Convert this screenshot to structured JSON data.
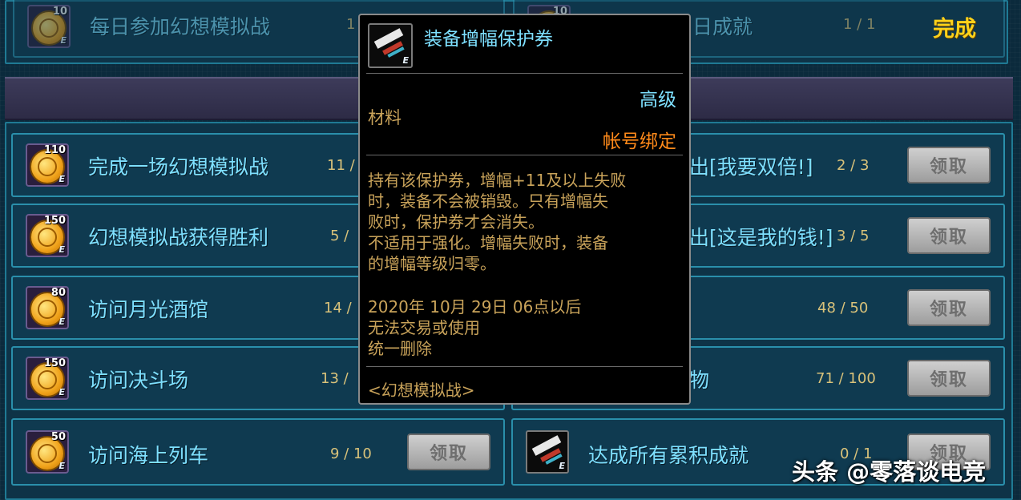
{
  "top_row": {
    "left": {
      "reward": "10",
      "task": "每日参加幻想模拟战",
      "progress": "1"
    },
    "right": {
      "reward": "10",
      "task": "日成就",
      "progress": "1 / 1",
      "status": "完成"
    }
  },
  "rows": [
    {
      "left": {
        "reward": "110",
        "task": "完成一场幻想模拟战",
        "progress": "11 /"
      },
      "right": {
        "task": "出[我要双倍!]",
        "progress": "2 / 3",
        "button": "领取"
      }
    },
    {
      "left": {
        "reward": "150",
        "task": "幻想模拟战获得胜利",
        "progress": "5 /"
      },
      "right": {
        "task": "出[这是我的钱!]",
        "progress": "3 / 5",
        "button": "领取"
      }
    },
    {
      "left": {
        "reward": "80",
        "task": "访问月光酒馆",
        "progress": "14 /"
      },
      "right": {
        "task": "",
        "progress": "48 / 50",
        "button": "领取"
      }
    },
    {
      "left": {
        "reward": "150",
        "task": "访问决斗场",
        "progress": "13 /"
      },
      "right": {
        "task": "物",
        "progress": "71 / 100",
        "button": "领取"
      }
    },
    {
      "left": {
        "reward": "50",
        "task": "访问海上列车",
        "progress": "9 / 10",
        "button": "领取"
      },
      "right": {
        "task": "达成所有累积成就",
        "progress": "0 / 1",
        "button": "领取"
      }
    }
  ],
  "tooltip": {
    "title": "装备增幅保护券",
    "grade": "高级",
    "type": "材料",
    "bind": "帐号绑定",
    "desc": [
      "持有该保护券，增幅+11及以上失败",
      "时，装备不会被销毁。只有增幅失",
      "败时，保护券才会消失。",
      "不适用于强化。增幅失败时，装备",
      "的增幅等级归零。"
    ],
    "expiry": [
      "2020年 10月 29日 06点以后",
      "无法交易或使用",
      "统一删除"
    ],
    "source": "<幻想模拟战>"
  },
  "watermark": "头条 @零落谈电竞",
  "colors": {
    "task_text": "#7ee0ff",
    "progress_text": "#d9c27a",
    "done_text": "#ffd21a",
    "grade_text": "#7ee0ff",
    "bind_text": "#ff8a1a",
    "desc_text": "#c9a35a"
  }
}
